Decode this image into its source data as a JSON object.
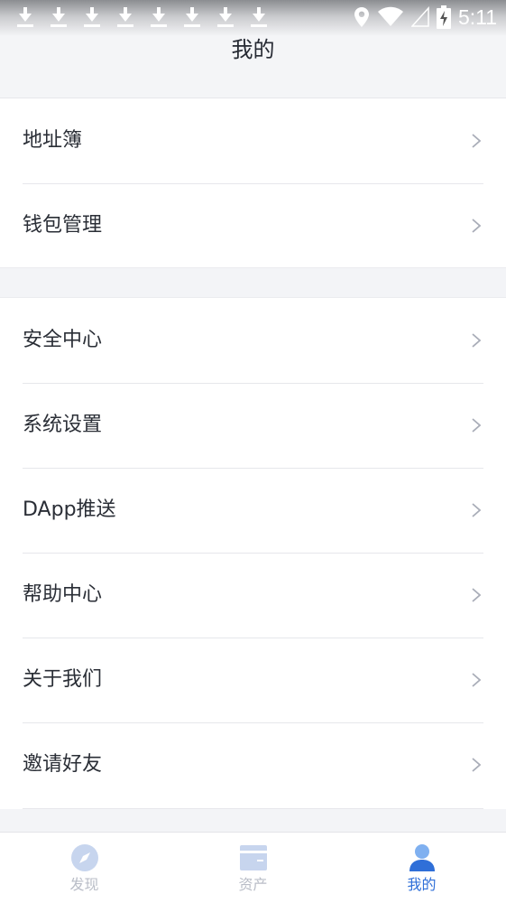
{
  "status_bar": {
    "time": "5:11"
  },
  "header": {
    "title": "我的"
  },
  "menu": {
    "group1": [
      {
        "label": "地址簿"
      },
      {
        "label": "钱包管理"
      }
    ],
    "group2": [
      {
        "label": "安全中心"
      },
      {
        "label": "系统设置"
      },
      {
        "label": "DApp推送"
      },
      {
        "label": "帮助中心"
      },
      {
        "label": "关于我们"
      },
      {
        "label": "邀请好友"
      }
    ]
  },
  "tabs": [
    {
      "label": "发现",
      "icon": "compass-icon",
      "active": false
    },
    {
      "label": "资产",
      "icon": "wallet-icon",
      "active": false
    },
    {
      "label": "我的",
      "icon": "person-icon",
      "active": true
    }
  ],
  "colors": {
    "accent": "#2f6fd8",
    "inactive": "#b9bdc7",
    "background": "#f3f4f7"
  }
}
